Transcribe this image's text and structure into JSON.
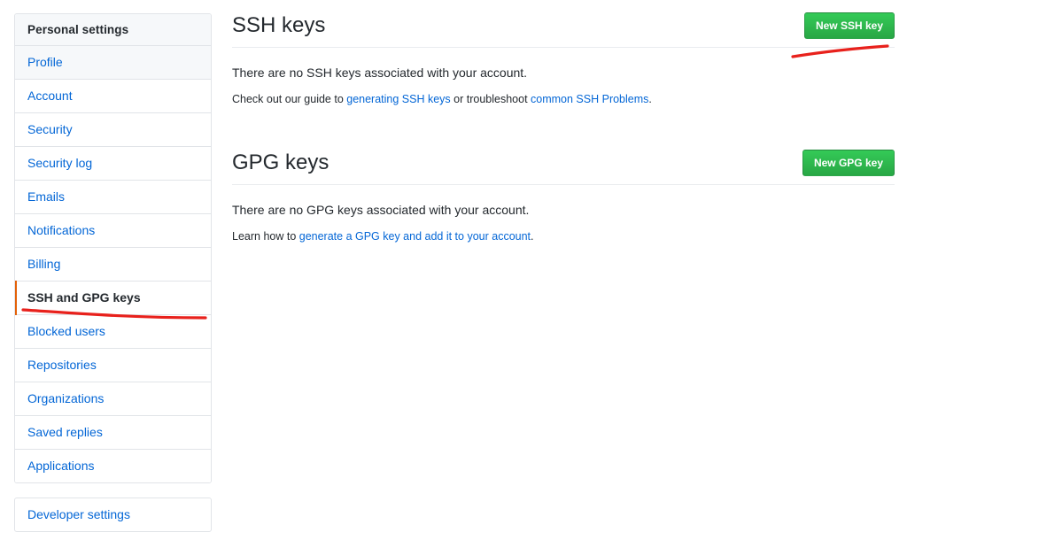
{
  "sidebar": {
    "header_label": "Personal settings",
    "items": [
      {
        "label": "Profile",
        "state": "tinted"
      },
      {
        "label": "Account",
        "state": "normal"
      },
      {
        "label": "Security",
        "state": "normal"
      },
      {
        "label": "Security log",
        "state": "normal"
      },
      {
        "label": "Emails",
        "state": "normal"
      },
      {
        "label": "Notifications",
        "state": "normal"
      },
      {
        "label": "Billing",
        "state": "normal"
      },
      {
        "label": "SSH and GPG keys",
        "state": "selected"
      },
      {
        "label": "Blocked users",
        "state": "normal"
      },
      {
        "label": "Repositories",
        "state": "normal"
      },
      {
        "label": "Organizations",
        "state": "normal"
      },
      {
        "label": "Saved replies",
        "state": "normal"
      },
      {
        "label": "Applications",
        "state": "normal"
      }
    ],
    "developer_settings_label": "Developer settings"
  },
  "ssh": {
    "title": "SSH keys",
    "button_label": "New SSH key",
    "empty_message": "There are no SSH keys associated with your account.",
    "help_prefix": "Check out our guide to ",
    "help_link_1": "generating SSH keys",
    "help_middle": " or troubleshoot ",
    "help_link_2": "common SSH Problems",
    "help_suffix": "."
  },
  "gpg": {
    "title": "GPG keys",
    "button_label": "New GPG key",
    "empty_message": "There are no GPG keys associated with your account.",
    "help_prefix": "Learn how to ",
    "help_link_1": "generate a GPG key and add it to your account",
    "help_suffix": "."
  },
  "colors": {
    "link": "#0366d6",
    "button_green": "#28a745",
    "active_marker": "#e36209",
    "annotation_red": "#e8211c",
    "border": "#e1e4e8",
    "tinted_row": "#f6f8fa"
  },
  "annotations": [
    {
      "name": "underline-new-ssh-key-button",
      "color": "#e8211c"
    },
    {
      "name": "underline-ssh-and-gpg-keys-nav",
      "color": "#e8211c"
    }
  ]
}
